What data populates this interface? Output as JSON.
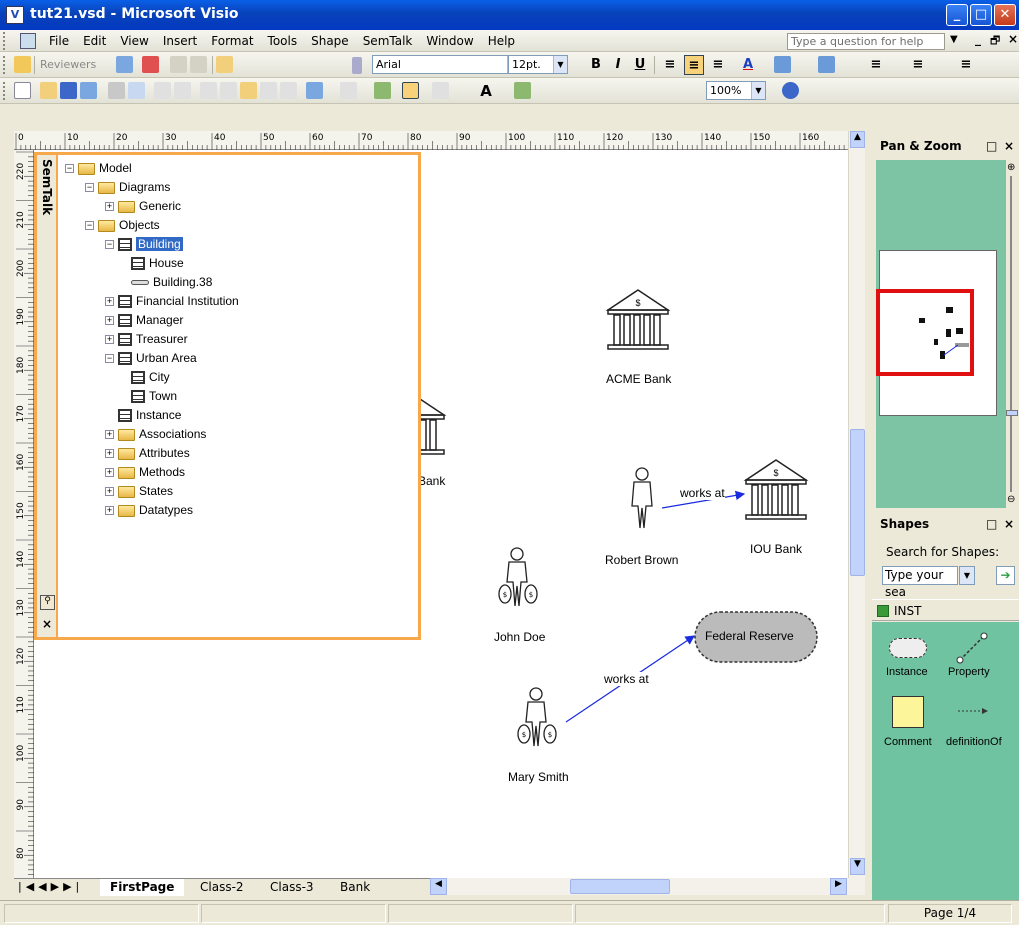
{
  "window": {
    "title": "tut21.vsd - Microsoft Visio"
  },
  "menu": {
    "items": [
      "File",
      "Edit",
      "View",
      "Insert",
      "Format",
      "Tools",
      "Shape",
      "SemTalk",
      "Window",
      "Help"
    ],
    "question_placeholder": "Type a question for help"
  },
  "toolbar": {
    "reviewers_label": "Reviewers",
    "font_name": "Arial",
    "font_size": "12pt.",
    "zoom": "100%"
  },
  "ruler": {
    "h_labels": [
      "0",
      "10",
      "20",
      "30",
      "40",
      "50",
      "60",
      "70",
      "80",
      "90",
      "100",
      "110",
      "120",
      "130",
      "140",
      "150",
      "160"
    ],
    "v_labels": [
      "220",
      "210",
      "200",
      "190",
      "180",
      "170",
      "160",
      "150",
      "140",
      "130",
      "120",
      "110",
      "100",
      "90",
      "80"
    ]
  },
  "semtalk": {
    "title": "SemTalk",
    "tree": [
      {
        "label": "Model",
        "icon": "folder-open"
      },
      {
        "label": "Diagrams",
        "icon": "folder-open"
      },
      {
        "label": "Generic",
        "icon": "folder"
      },
      {
        "label": "Objects",
        "icon": "folder-open"
      },
      {
        "label": "Building",
        "icon": "class"
      },
      {
        "label": "House",
        "icon": "class"
      },
      {
        "label": "Building.38",
        "icon": "instance"
      },
      {
        "label": "Financial Institution",
        "icon": "class"
      },
      {
        "label": "Manager",
        "icon": "class"
      },
      {
        "label": "Treasurer",
        "icon": "class"
      },
      {
        "label": "Urban Area",
        "icon": "class"
      },
      {
        "label": "City",
        "icon": "class"
      },
      {
        "label": "Town",
        "icon": "class"
      },
      {
        "label": "Instance",
        "icon": "class"
      },
      {
        "label": "Associations",
        "icon": "folder"
      },
      {
        "label": "Attributes",
        "icon": "folder"
      },
      {
        "label": "Methods",
        "icon": "folder"
      },
      {
        "label": "States",
        "icon": "folder"
      },
      {
        "label": "Datatypes",
        "icon": "folder"
      }
    ]
  },
  "canvas": {
    "acme_bank": "ACME Bank",
    "partial_bank": "Bank",
    "iou_bank": "IOU Bank",
    "robert_brown": "Robert Brown",
    "john_doe": "John Doe",
    "mary_smith": "Mary Smith",
    "federal_reserve": "Federal Reserve",
    "works_at_1": "works at",
    "works_at_2": "works at"
  },
  "page_tabs": [
    "FirstPage",
    "Class-2",
    "Class-3",
    "Bank"
  ],
  "pan_zoom": {
    "title": "Pan & Zoom"
  },
  "shapes": {
    "title": "Shapes",
    "search_label": "Search for Shapes:",
    "search_value": "Type your sea",
    "stencil_name": "INST",
    "items": [
      "Instance",
      "Property",
      "Comment",
      "definitionOf"
    ]
  },
  "status": {
    "page": "Page 1/4"
  },
  "colors": {
    "accent_orange": "#f7a84a",
    "title_blue": "#0842b8",
    "stencil_green": "#6fc3a0"
  }
}
